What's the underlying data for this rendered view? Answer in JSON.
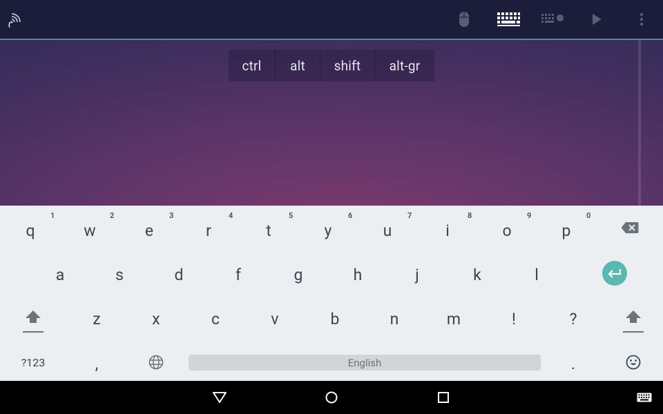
{
  "appbar": {
    "left_icon": "remote-connect-icon",
    "actions": [
      "mouse-icon",
      "keyboard-icon",
      "keyboard-settings-icon",
      "play-icon",
      "overflow-menu-icon"
    ]
  },
  "modifiers": [
    "ctrl",
    "alt",
    "shift",
    "alt-gr"
  ],
  "keyboard": {
    "row1": [
      {
        "key": "q",
        "hint": "1"
      },
      {
        "key": "w",
        "hint": "2"
      },
      {
        "key": "e",
        "hint": "3"
      },
      {
        "key": "r",
        "hint": "4"
      },
      {
        "key": "t",
        "hint": "5"
      },
      {
        "key": "y",
        "hint": "6"
      },
      {
        "key": "u",
        "hint": "7"
      },
      {
        "key": "i",
        "hint": "8"
      },
      {
        "key": "o",
        "hint": "9"
      },
      {
        "key": "p",
        "hint": "0"
      }
    ],
    "row2": [
      "a",
      "s",
      "d",
      "f",
      "g",
      "h",
      "j",
      "k",
      "l"
    ],
    "row3": [
      "z",
      "x",
      "c",
      "v",
      "b",
      "n",
      "m",
      "!",
      "?"
    ],
    "symbols_label": "?123",
    "comma": ",",
    "period": ".",
    "space_label": "English"
  },
  "colors": {
    "accent": "#3a9b96",
    "enter": "#5ab8b1",
    "keyboard_bg": "#eceff1",
    "appbar_bg": "#1c1d3a"
  }
}
